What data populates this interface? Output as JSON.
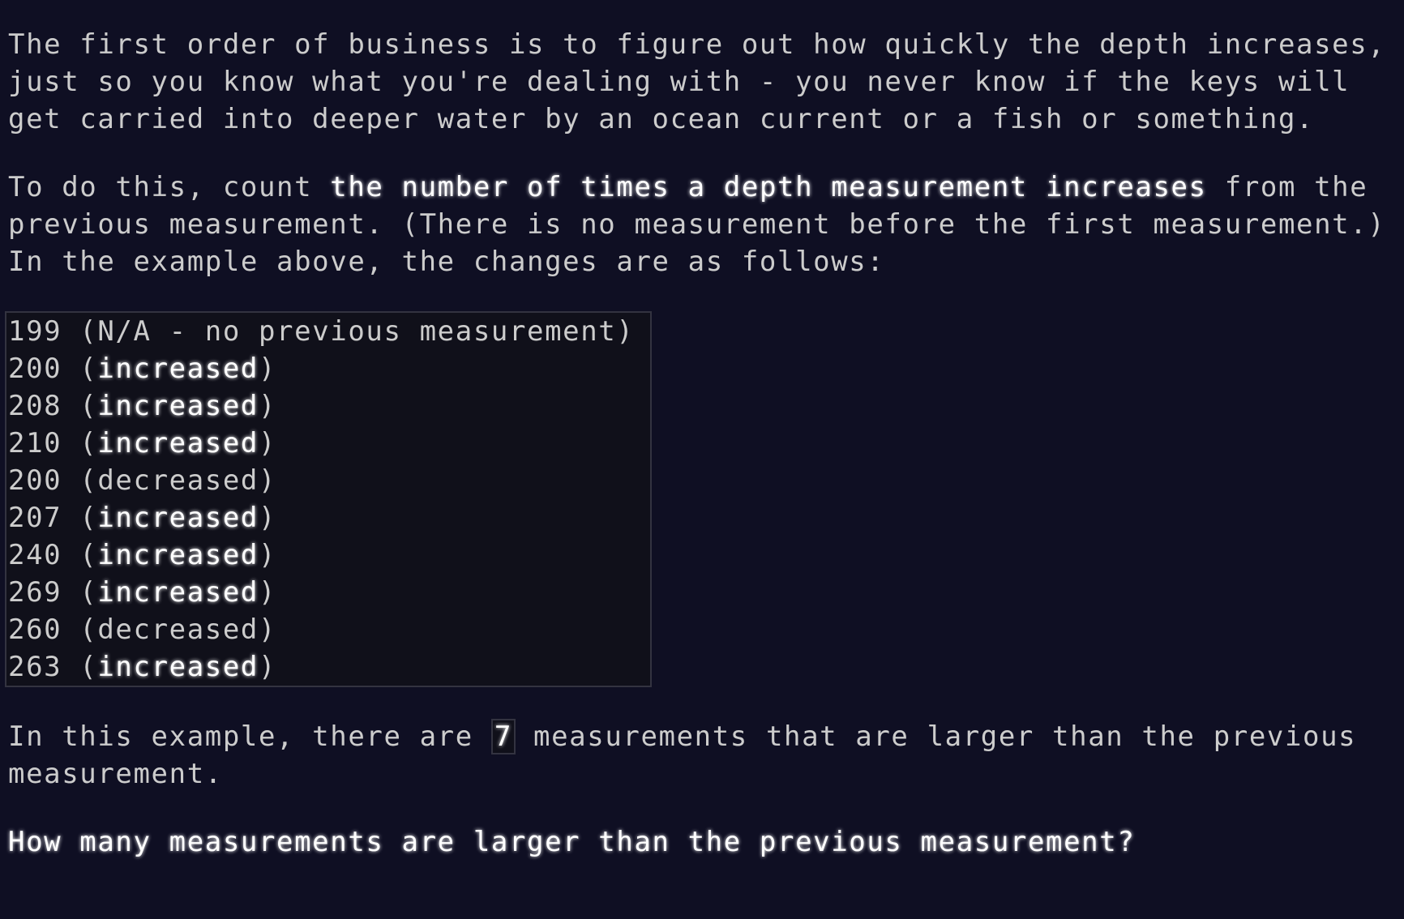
{
  "colors": {
    "background": "#0f0f23",
    "text": "#cccccc",
    "emphasis": "#ffffff",
    "code_background": "#10101a",
    "code_border": "#333340"
  },
  "paragraph_1": {
    "text": "The first order of business is to figure out how quickly the depth increases, just so you know what you're dealing with - you never know if the keys will get carried into deeper water by an ocean current or a fish or something."
  },
  "paragraph_2": {
    "before": "To do this, count ",
    "emphasis": "the number of times a depth measurement increases",
    "after": " from the previous measurement. (There is no measurement before the first measurement.) In the example above, the changes are as follows:"
  },
  "example_block": {
    "rows": [
      {
        "value": "199",
        "note": "N/A - no previous measurement",
        "emphasized": false
      },
      {
        "value": "200",
        "note": "increased",
        "emphasized": true
      },
      {
        "value": "208",
        "note": "increased",
        "emphasized": true
      },
      {
        "value": "210",
        "note": "increased",
        "emphasized": true
      },
      {
        "value": "200",
        "note": "decreased",
        "emphasized": false
      },
      {
        "value": "207",
        "note": "increased",
        "emphasized": true
      },
      {
        "value": "240",
        "note": "increased",
        "emphasized": true
      },
      {
        "value": "269",
        "note": "increased",
        "emphasized": true
      },
      {
        "value": "260",
        "note": "decreased",
        "emphasized": false
      },
      {
        "value": "263",
        "note": "increased",
        "emphasized": true
      }
    ]
  },
  "paragraph_3": {
    "before": "In this example, there are ",
    "answer": "7",
    "after": " measurements that are larger than the previous measurement."
  },
  "question": {
    "text": "How many measurements are larger than the previous measurement?"
  }
}
